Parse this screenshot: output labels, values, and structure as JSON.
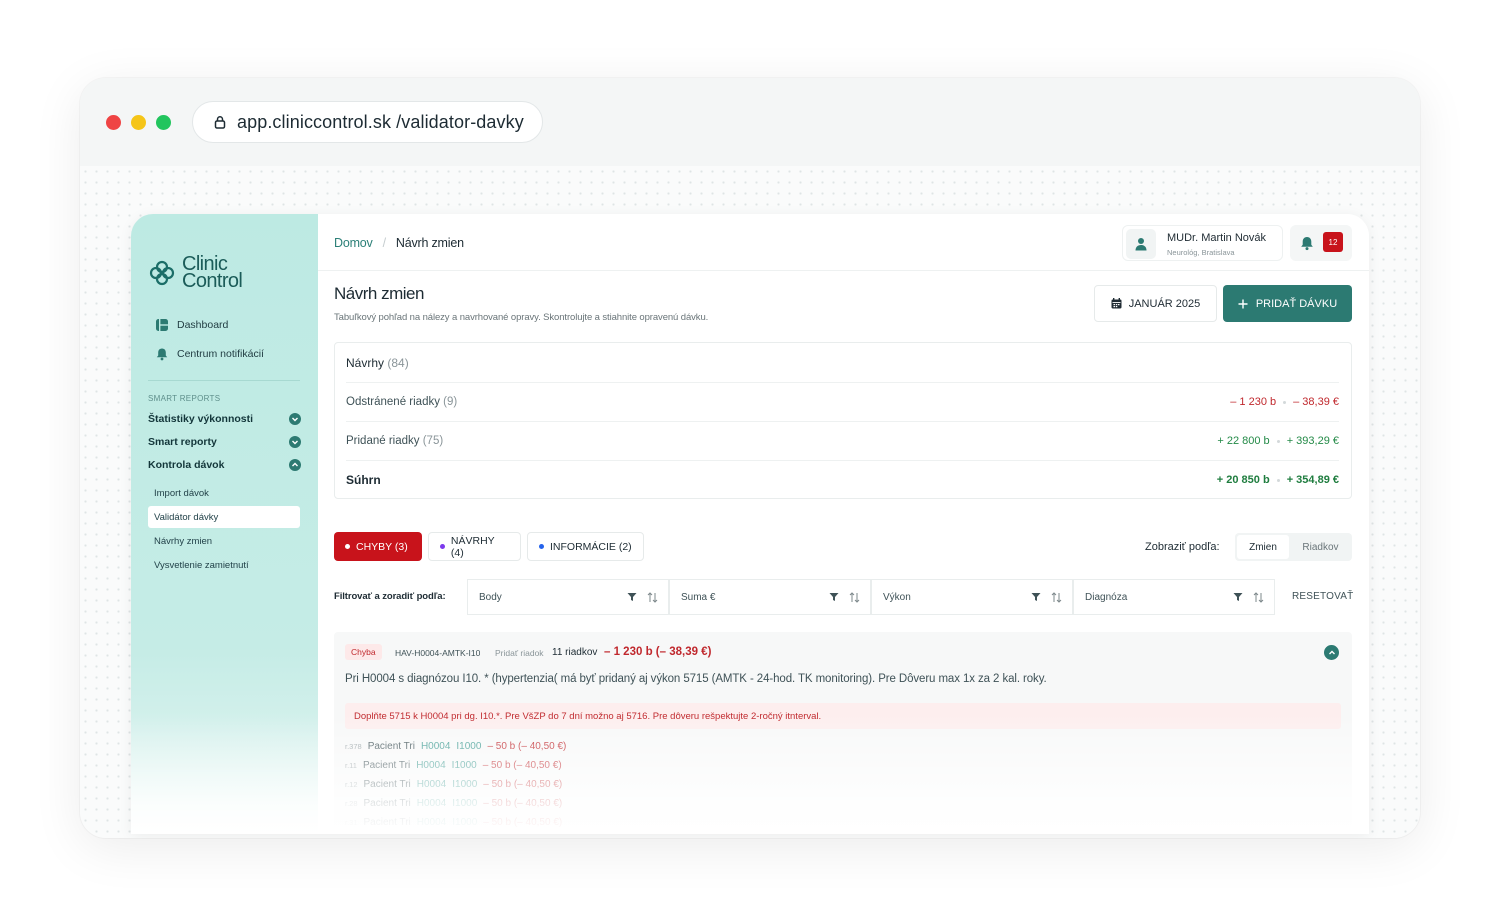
{
  "browser": {
    "url": "app.cliniccontrol.sk /validator-davky"
  },
  "logo": {
    "line1": "Clinic",
    "line2": "Control"
  },
  "sidebar": {
    "items": [
      {
        "label": "Dashboard",
        "icon": "dashboard-icon"
      },
      {
        "label": "Centrum notifikácií",
        "icon": "bell-icon"
      }
    ],
    "section_label": "SMART REPORTS",
    "groups": [
      {
        "label": "Štatistiky výkonnosti",
        "expanded": false
      },
      {
        "label": "Smart reporty",
        "expanded": false
      },
      {
        "label": "Kontrola dávok",
        "expanded": true
      }
    ],
    "sub_items": [
      {
        "label": "Import dávok",
        "active": false
      },
      {
        "label": "Validátor dávky",
        "active": true
      },
      {
        "label": "Návrhy zmien",
        "active": false
      },
      {
        "label": "Vysvetlenie zamietnutí",
        "active": false
      }
    ]
  },
  "header": {
    "breadcrumb": {
      "home": "Domov",
      "separator": "/",
      "current": "Návrh zmien"
    },
    "user": {
      "name": "MUDr. Martin Novák",
      "role": "Neurológ, Bratislava"
    },
    "notifications": {
      "count": "12"
    }
  },
  "page": {
    "title": "Návrh zmien",
    "subtitle": "Tabuľkový pohľad na nálezy a navrhované opravy. Skontrolujte a stiahnite opravenú dávku.",
    "month_button": "JANUÁR 2025",
    "add_button": "PRIDAŤ DÁVKU"
  },
  "summary": {
    "title": "Návrhy",
    "title_count": "(84)",
    "rows": [
      {
        "label": "Odstránené riadky",
        "count": "(9)",
        "points": "– 1 230 b",
        "amount": "– 38,39 €",
        "kind": "negative"
      },
      {
        "label": "Pridané riadky",
        "count": "(75)",
        "points": "+ 22 800 b",
        "amount": "+ 393,29 €",
        "kind": "positive"
      }
    ],
    "total": {
      "label": "Súhrn",
      "points": "+ 20 850 b",
      "amount": "+ 354,89 €"
    }
  },
  "tabs": [
    {
      "label": "CHYBY (3)",
      "dot_color": "#ffffff"
    },
    {
      "label": "NÁVRHY (4)",
      "dot_color": "#7c3aed"
    },
    {
      "label": "INFORMÁCIE (2)",
      "dot_color": "#2563eb"
    }
  ],
  "view_toggle": {
    "label": "Zobraziť podľa:",
    "options": [
      "Zmien",
      "Riadkov"
    ],
    "selected": "Zmien"
  },
  "filters": {
    "label": "Filtrovať a zoradiť podľa:",
    "columns": [
      "Body",
      "Suma €",
      "Výkon",
      "Diagnóza"
    ],
    "reset": "RESETOVAŤ"
  },
  "finding": {
    "type": "Chyba",
    "rule_id": "HAV-H0004-AMTK-I10",
    "action": "Pridať riadok",
    "rows_count": "11 riadkov",
    "delta": "– 1 230 b (– 38,39 €)",
    "description": "Pri H0004 s diagnózou I10. * (hypertenzia( má byť pridaný aj výkon 5715 (AMTK - 24-hod. TK monitoring). Pre Dôveru max 1x za 2 kal. roky.",
    "alert": "Doplňte 5715 k H0004 pri dg. I10.*. Pre VšZP do 7 dní možno aj 5716. Pre dôveru rešpektujte 2-ročný itnterval.",
    "rows": [
      {
        "rid": "r.378",
        "patient": "Pacient Tri",
        "code": "H0004",
        "dg": "I1000",
        "value": "– 50 b (– 40,50 €)"
      },
      {
        "rid": "r.11",
        "patient": "Pacient Tri",
        "code": "H0004",
        "dg": "I1000",
        "value": "– 50 b (– 40,50 €)"
      },
      {
        "rid": "r.12",
        "patient": "Pacient Tri",
        "code": "H0004",
        "dg": "I1000",
        "value": "– 50 b (– 40,50 €)"
      },
      {
        "rid": "r.28",
        "patient": "Pacient Tri",
        "code": "H0004",
        "dg": "I1000",
        "value": "– 50 b (– 40,50 €)"
      },
      {
        "rid": "r.31",
        "patient": "Pacient Tri",
        "code": "H0004",
        "dg": "I1000",
        "value": "– 50 b (– 40,50 €)"
      }
    ]
  },
  "colors": {
    "brand": "#2c7a72",
    "sidebar": "#bdeae3",
    "error": "#c8131b",
    "positive": "#238a47",
    "negative": "#c0282d"
  }
}
